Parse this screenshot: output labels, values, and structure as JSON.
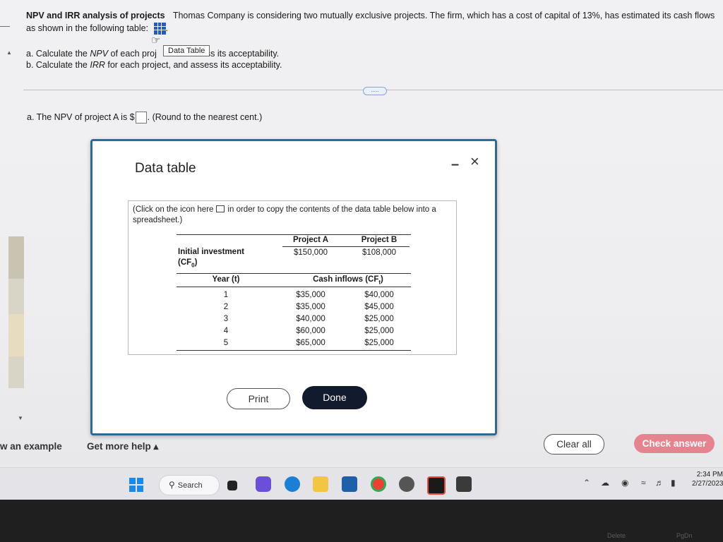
{
  "question": {
    "title": "NPV and IRR analysis of projects",
    "intro": "Thomas Company is considering two mutually exclusive projects. The firm, which has a cost of capital of 13%, has estimated its cash flows as shown in the following table:",
    "part_a_prefix": "a. Calculate the ",
    "part_a_term": "NPV",
    "part_a_mid": " of each proj",
    "part_a_suffix": "ss its acceptability.",
    "part_b_prefix": "b. Calculate the ",
    "part_b_term": "IRR",
    "part_b_suffix": " for each project, and assess its acceptability.",
    "tooltip": "Data Table",
    "more_label": "....."
  },
  "answer": {
    "prefix": "a. The NPV of project A is $",
    "suffix": ". (Round to the nearest cent.)"
  },
  "modal": {
    "title": "Data table",
    "minimize_glyph": "–",
    "close_glyph": "×",
    "copy_note_before": "(Click on the icon here",
    "copy_note_after": "in order to copy the contents of the data table below into a spreadsheet.)",
    "table": {
      "headers": [
        "Project A",
        "Project B"
      ],
      "initial_label": "Initial investment",
      "initial_sub": "(CF",
      "initial_sub_idx": "0",
      "initial_values": [
        "$150,000",
        "$108,000"
      ],
      "year_label": "Year (t)",
      "cash_label": "Cash inflows (CF",
      "cash_sub": "t",
      "rows": [
        {
          "year": "1",
          "a": "$35,000",
          "b": "$40,000"
        },
        {
          "year": "2",
          "a": "$35,000",
          "b": "$45,000"
        },
        {
          "year": "3",
          "a": "$40,000",
          "b": "$25,000"
        },
        {
          "year": "4",
          "a": "$60,000",
          "b": "$25,000"
        },
        {
          "year": "5",
          "a": "$65,000",
          "b": "$25,000"
        }
      ]
    },
    "print_label": "Print",
    "done_label": "Done"
  },
  "footer": {
    "example": "w an example",
    "help": "Get more help ▴",
    "clear": "Clear all",
    "check": "Check answer"
  },
  "taskbar": {
    "search": "Search",
    "time": "2:34 PM",
    "date": "2/27/2023"
  },
  "keyboard": {
    "key1": "Delete",
    "key2": "PgDn"
  }
}
